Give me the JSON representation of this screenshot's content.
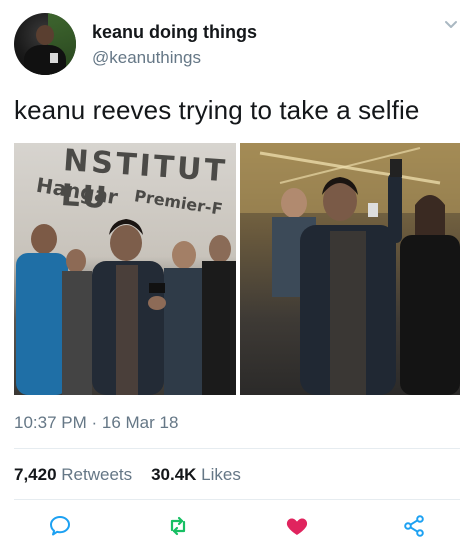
{
  "user": {
    "display_name": "keanu doing things",
    "handle": "@keanuthings",
    "avatar_icon": "avatar-photo"
  },
  "tweet": {
    "text": "keanu reeves trying to take a selfie",
    "timestamp": "10:37 PM · 16 Mar 18"
  },
  "photos": {
    "left": {
      "sign_line1": "NSTITUT LU",
      "sign_line2": "Hangar",
      "sign_line3": "Premier-F"
    },
    "right": {}
  },
  "stats": {
    "retweets_count": "7,420",
    "retweets_label": "Retweets",
    "likes_count": "30.4K",
    "likes_label": "Likes"
  },
  "actions": [
    {
      "name": "reply",
      "icon": "reply-icon",
      "color": "#1da1f2"
    },
    {
      "name": "retweet",
      "icon": "retweet-icon",
      "color": "#17bf63"
    },
    {
      "name": "like",
      "icon": "heart-icon",
      "color": "#e0245e"
    },
    {
      "name": "share",
      "icon": "share-icon",
      "color": "#1da1f2"
    }
  ],
  "colors": {
    "text": "#14171a",
    "muted": "#657786",
    "divider": "#e6ecf0"
  }
}
